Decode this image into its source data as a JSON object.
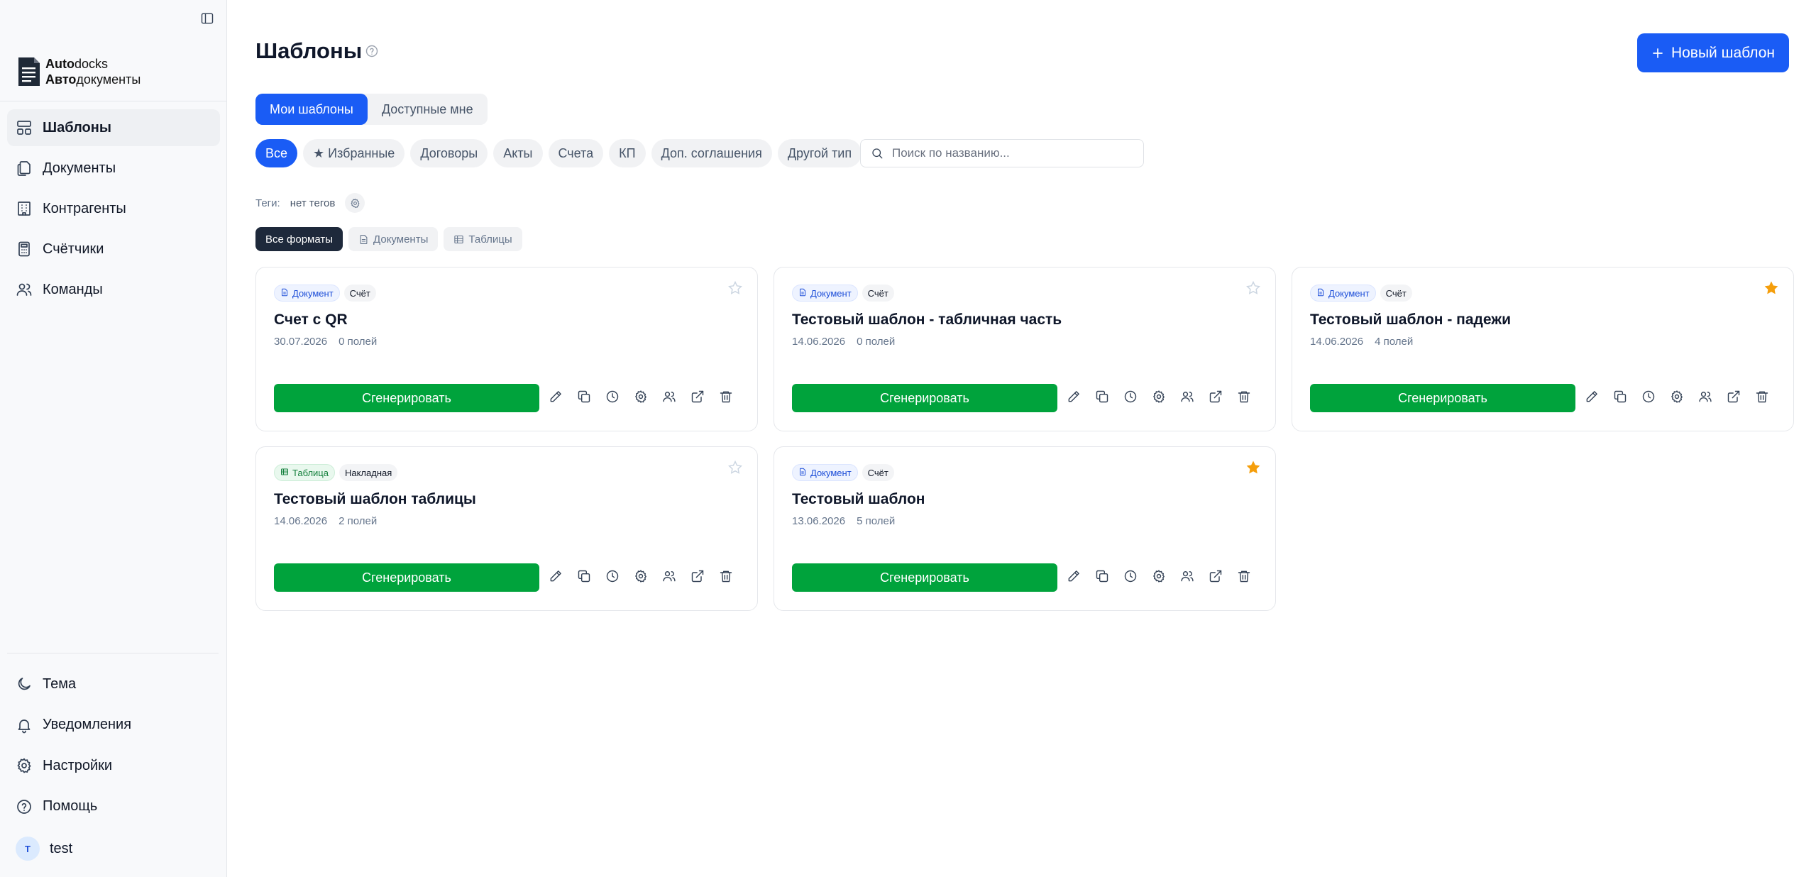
{
  "sidebar": {
    "logo": {
      "line1_bold": "Auto",
      "line1_rest": "docks",
      "line2_bold": "Авто",
      "line2_rest": "документы"
    },
    "nav": [
      {
        "label": "Шаблоны",
        "icon": "layout-icon",
        "active": true
      },
      {
        "label": "Документы",
        "icon": "files-icon"
      },
      {
        "label": "Контрагенты",
        "icon": "building-icon"
      },
      {
        "label": "Счётчики",
        "icon": "calculator-icon"
      },
      {
        "label": "Команды",
        "icon": "users-icon"
      }
    ],
    "bottom": [
      {
        "label": "Тема",
        "icon": "moon-icon"
      },
      {
        "label": "Уведомления",
        "icon": "bell-icon"
      },
      {
        "label": "Настройки",
        "icon": "gear-icon"
      },
      {
        "label": "Помощь",
        "icon": "help-circle-icon"
      }
    ],
    "user": {
      "initial": "T",
      "name": "test"
    }
  },
  "header": {
    "title": "Шаблоны",
    "new_button": "Новый шаблон"
  },
  "tabs": [
    {
      "label": "Мои шаблоны",
      "active": true
    },
    {
      "label": "Доступные мне",
      "active": false
    }
  ],
  "filters": [
    {
      "label": "Все",
      "active": true
    },
    {
      "label": "★ Избранные"
    },
    {
      "label": "Договоры"
    },
    {
      "label": "Акты"
    },
    {
      "label": "Счета"
    },
    {
      "label": "КП"
    },
    {
      "label": "Доп. соглашения"
    },
    {
      "label": "Другой тип"
    }
  ],
  "search": {
    "placeholder": "Поиск по названию...",
    "value": ""
  },
  "tags": {
    "label": "Теги:",
    "empty": "нет тегов"
  },
  "formats": [
    {
      "label": "Все форматы",
      "active": true
    },
    {
      "label": "Документы",
      "icon": "document-icon"
    },
    {
      "label": "Таблицы",
      "icon": "table-icon"
    }
  ],
  "cards": [
    {
      "format": "Документ",
      "format_kind": "doc",
      "type": "Счёт",
      "title": "Счет с QR",
      "date": "30.07.2026",
      "fields": "0 полей",
      "favorite": false,
      "generate": "Сгенерировать"
    },
    {
      "format": "Документ",
      "format_kind": "doc",
      "type": "Счёт",
      "title": "Тестовый шаблон - табличная часть",
      "date": "14.06.2026",
      "fields": "0 полей",
      "favorite": false,
      "generate": "Сгенерировать"
    },
    {
      "format": "Документ",
      "format_kind": "doc",
      "type": "Счёт",
      "title": "Тестовый шаблон - падежи",
      "date": "14.06.2026",
      "fields": "4 полей",
      "favorite": true,
      "generate": "Сгенерировать"
    },
    {
      "format": "Таблица",
      "format_kind": "tbl",
      "type": "Накладная",
      "title": "Тестовый шаблон таблицы",
      "date": "14.06.2026",
      "fields": "2 полей",
      "favorite": false,
      "generate": "Сгенерировать"
    },
    {
      "format": "Документ",
      "format_kind": "doc",
      "type": "Счёт",
      "title": "Тестовый шаблон",
      "date": "13.06.2026",
      "fields": "5 полей",
      "favorite": true,
      "generate": "Сгенерировать"
    }
  ],
  "colors": {
    "accent": "#1a5cf5",
    "generate": "#00a33c",
    "star": "#f59e0b"
  }
}
